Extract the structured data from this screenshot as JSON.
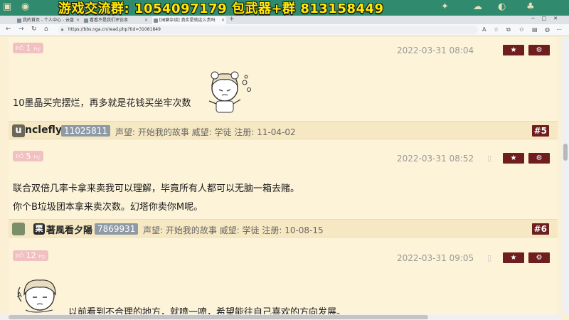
{
  "overlay": {
    "text": "游戏交流群: 1054097179  包武器+群 813158449"
  },
  "browser": {
    "tabs": [
      {
        "label": "我的首页 - 个人中心 - 云盘"
      },
      {
        "label": "看看不是我们评论本"
      },
      {
        "label": "[闲聊杂谈] 真实是就这么贵吗"
      }
    ],
    "url": "https://bbs.nga.cn/read.php?tid=31081849"
  },
  "posts": [
    {
      "votes": "1",
      "date": "2022-03-31 08:04",
      "lines": [
        "10墨晶买完摆烂，再多就是花钱买坐牢次数"
      ]
    },
    {
      "votes": "5",
      "date": "2022-03-31 08:52",
      "lines": [
        "联合双倍几率卡拿来卖我可以理解，毕竟所有人都可以无脑一箱去赌。",
        "你个B垃圾团本拿来卖次数。幻塔你卖你M呢。"
      ]
    },
    {
      "votes": "12",
      "date": "2022-03-31 09:05",
      "lines": [
        "以前看到不合理的地方，就喷一喷，希望能往自己喜欢的方向发展。"
      ]
    }
  ],
  "users": [
    {
      "avatar_letter": "u",
      "name": "nclefly",
      "uid": "11025811",
      "meta": "声望: 开始我的故事  威望: 学徒  注册: 11-04-02",
      "floor": "#5"
    },
    {
      "avatar_letter": "栗",
      "name": "著風看夕陽",
      "uid": "7869931",
      "meta": "声望: 开始我的故事  威望: 学徒  注册: 10-08-15",
      "floor": "#6"
    }
  ],
  "icons": {
    "thumb_up": "thumbs-up-icon",
    "thumb_down": "thumbs-down-icon",
    "star": "star-icon",
    "gear": "gear-icon"
  },
  "colors": {
    "accent": "#6e1e1e",
    "vote": "#f1c0c0",
    "page_bg": "#fcf0d4"
  }
}
